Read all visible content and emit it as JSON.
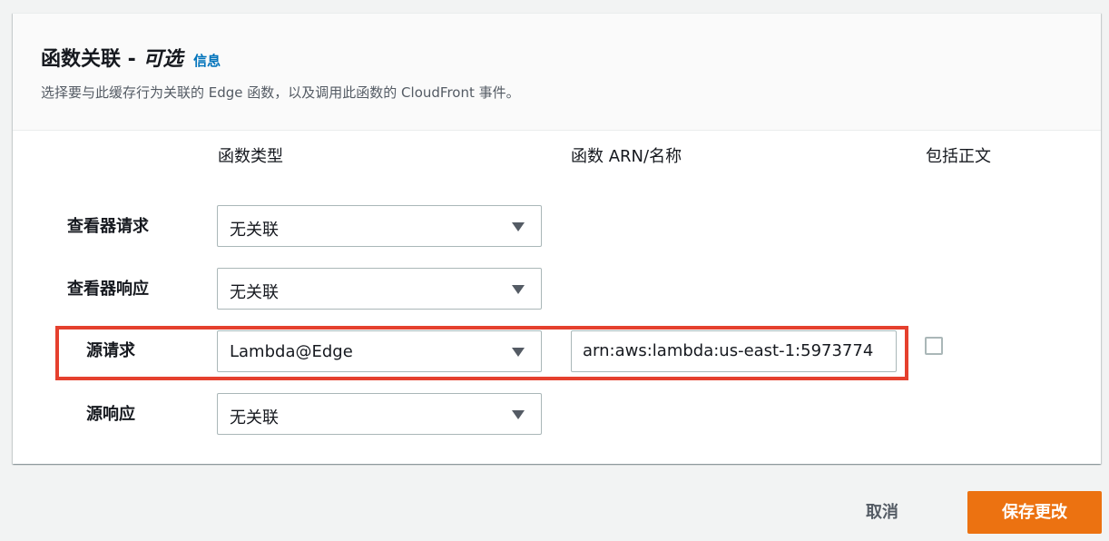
{
  "header": {
    "title": "函数关联 -",
    "optional": "可选",
    "info_link": "信息",
    "description": "选择要与此缓存行为关联的 Edge 函数，以及调用此函数的 CloudFront 事件。"
  },
  "columns": {
    "function_type": "函数类型",
    "function_arn": "函数 ARN/名称",
    "include_body": "包括正文"
  },
  "rows": [
    {
      "label": "查看器请求",
      "selected": "无关联"
    },
    {
      "label": "查看器响应",
      "selected": "无关联"
    },
    {
      "label": "源请求",
      "selected": "Lambda@Edge",
      "arn_value": "arn:aws:lambda:us-east-1:5973774",
      "include_body_checked": false
    },
    {
      "label": "源响应",
      "selected": "无关联"
    }
  ],
  "footer": {
    "cancel_label": "取消",
    "save_label": "保存更改"
  },
  "colors": {
    "primary_button": "#ec7211",
    "link": "#0073bb",
    "highlight_border": "#e5402e"
  }
}
